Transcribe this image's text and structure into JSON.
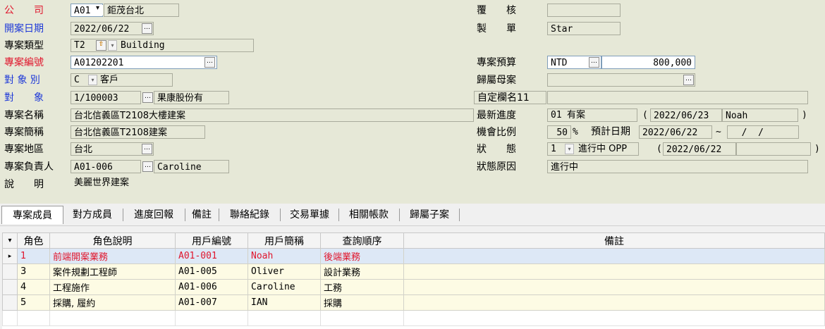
{
  "labels": {
    "company": "公　　司",
    "open_date": "開案日期",
    "project_type": "專案類型",
    "project_no": "專案編號",
    "object_type": "對 象 別",
    "object": "對　　象",
    "project_name": "專案名稱",
    "project_short": "專案簡稱",
    "project_area": "專案地區",
    "manager": "專案負責人",
    "description": "說　　明",
    "review": "覆　　核",
    "creator": "製　　單",
    "budget": "專案預算",
    "parent": "歸屬母案",
    "custom": "自定欄名11",
    "progress": "最新進度",
    "chance": "機會比例",
    "status": "狀　　態",
    "status_reason": "狀態原因"
  },
  "fields": {
    "company_code": "A01",
    "company_name": "鉅茂台北",
    "open_date": "2022/06/22",
    "type_code": "T2",
    "type_name": "Building",
    "project_no": "A01202201",
    "object_type_code": "C",
    "object_type_name": "客戶",
    "object_code": "1/100003",
    "object_name": "果康股份有",
    "project_name": "台北信義區T2108大樓建案",
    "project_short": "台北信義區T2108建案",
    "area": "台北",
    "manager_code": "A01-006",
    "manager_name": "Caroline",
    "description": "美麗世界建案",
    "review": "",
    "creator": "Star",
    "currency": "NTD",
    "budget": "800,000",
    "parent": "",
    "custom": "",
    "progress_code": "01",
    "progress_name": "有案",
    "progress_date": "2022/06/23",
    "progress_user": "Noah",
    "chance_pct": "50",
    "pct_sign": "%",
    "est_date_label": "預計日期",
    "est_date_from": "2022/06/22",
    "tilde": "~",
    "est_date_to": "  /  /",
    "status_code": "1",
    "status_name": "進行中 OPP",
    "status_date": "2022/06/22",
    "status_extra": "",
    "status_reason": "進行中",
    "paren_open": "(",
    "paren_close": ")",
    "dots": "…"
  },
  "icons": {
    "up": "⇧",
    "down": "▾"
  },
  "tabs": [
    "專案成員",
    "對方成員",
    "進度回報",
    "備註",
    "聯絡紀錄",
    "交易單據",
    "相關帳款",
    "歸屬子案"
  ],
  "grid": {
    "corner": "▾",
    "columns": [
      "角色",
      "角色說明",
      "用戶編號",
      "用戶簡稱",
      "查詢順序",
      "備註"
    ],
    "pointer": "▸",
    "rows": [
      {
        "role": "1",
        "desc": "前端開案業務",
        "uid": "A01-001",
        "uname": "Noah",
        "query": "後端業務",
        "note": ""
      },
      {
        "role": "3",
        "desc": "案件規劃工程師",
        "uid": "A01-005",
        "uname": "Oliver",
        "query": "設計業務",
        "note": ""
      },
      {
        "role": "4",
        "desc": "工程施作",
        "uid": "A01-006",
        "uname": "Caroline",
        "query": "工務",
        "note": ""
      },
      {
        "role": "5",
        "desc": "採購, 履約",
        "uid": "A01-007",
        "uname": "IAN",
        "query": "採購",
        "note": ""
      }
    ]
  },
  "colors": {
    "form_bg": "#e6e8d7",
    "label_blue": "#1f3ad8",
    "label_red": "#e0162d",
    "row_selected": "#dde8f6",
    "row_normal": "#fdfbe4"
  }
}
